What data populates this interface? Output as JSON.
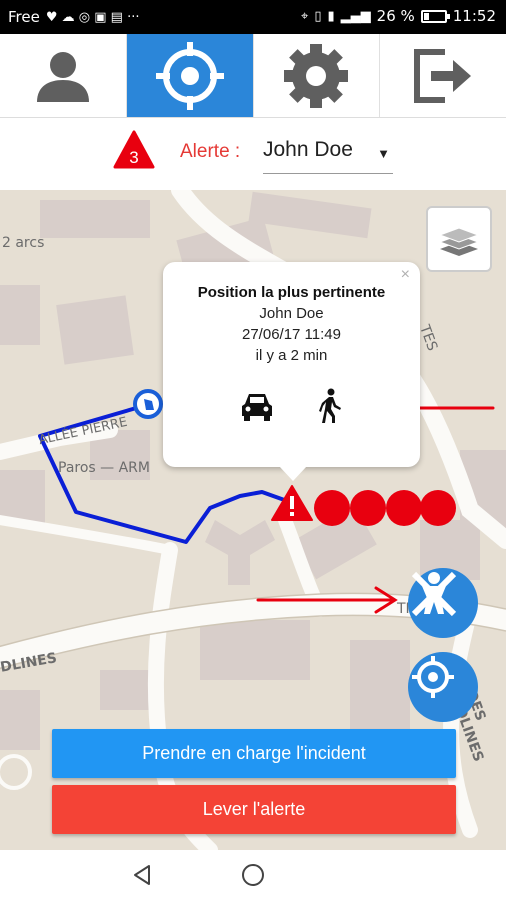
{
  "status_bar": {
    "carrier": "Free",
    "battery": "26 %",
    "time": "11:52"
  },
  "nav_tabs": [
    {
      "name": "profile",
      "icon": "user-icon",
      "active": false
    },
    {
      "name": "location",
      "icon": "crosshair-icon",
      "active": true
    },
    {
      "name": "settings",
      "icon": "gear-icon",
      "active": false
    },
    {
      "name": "logout",
      "icon": "logout-icon",
      "active": false
    }
  ],
  "alert": {
    "count": "3",
    "label": "Alerte :",
    "selected": "John Doe"
  },
  "map": {
    "labels": [
      "2 arcs",
      "ALLÉE PIERRE",
      "Paros — ARM",
      "TES",
      "TI",
      "DLINES",
      "DES DOLINES"
    ]
  },
  "popup": {
    "title": "Position la plus pertinente",
    "name": "John Doe",
    "datetime": "27/06/17 11:49",
    "ago": "il y a 2 min",
    "close": "×"
  },
  "actions": {
    "take_charge": "Prendre en charge l'incident",
    "lift_alert": "Lever l'alerte"
  },
  "colors": {
    "primary": "#2196f3",
    "nav_active": "#2b86d9",
    "danger": "#f44336",
    "alert_red": "#e8000f",
    "track_blue": "#0a1fd6",
    "map_bg": "#e6dfd3"
  }
}
